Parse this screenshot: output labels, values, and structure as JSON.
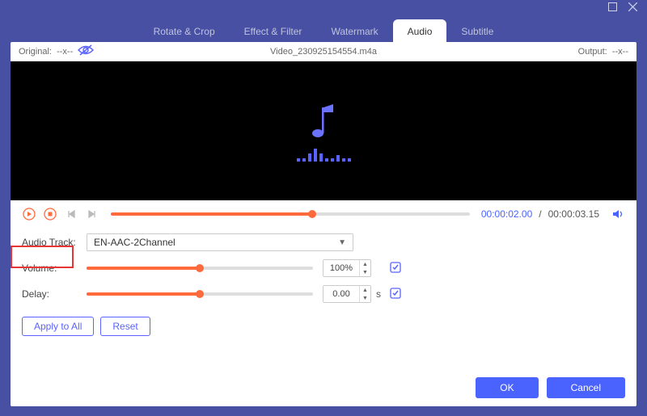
{
  "window": {
    "tabs": [
      "Rotate & Crop",
      "Effect & Filter",
      "Watermark",
      "Audio",
      "Subtitle"
    ],
    "active_tab_index": 3
  },
  "filebar": {
    "original_label": "Original:",
    "original_value": "--x--",
    "filename": "Video_230925154554.m4a",
    "output_label": "Output:",
    "output_value": "--x--"
  },
  "playback": {
    "progress_pct": 56,
    "time_current": "00:00:02.00",
    "time_separator": "/",
    "time_duration": "00:00:03.15"
  },
  "audio": {
    "track_label": "Audio Track:",
    "track_value": "EN-AAC-2Channel",
    "volume_label": "Volume:",
    "volume_value": "100%",
    "volume_slider_pct": 50,
    "delay_label": "Delay:",
    "delay_value": "0.00",
    "delay_unit": "s",
    "delay_slider_pct": 50
  },
  "buttons": {
    "apply_all": "Apply to All",
    "reset": "Reset",
    "ok": "OK",
    "cancel": "Cancel"
  },
  "colors": {
    "accent_purple": "#4850a4",
    "accent_orange": "#ff6a3d",
    "accent_blue": "#4a63ff",
    "highlight_red": "#e53535"
  }
}
